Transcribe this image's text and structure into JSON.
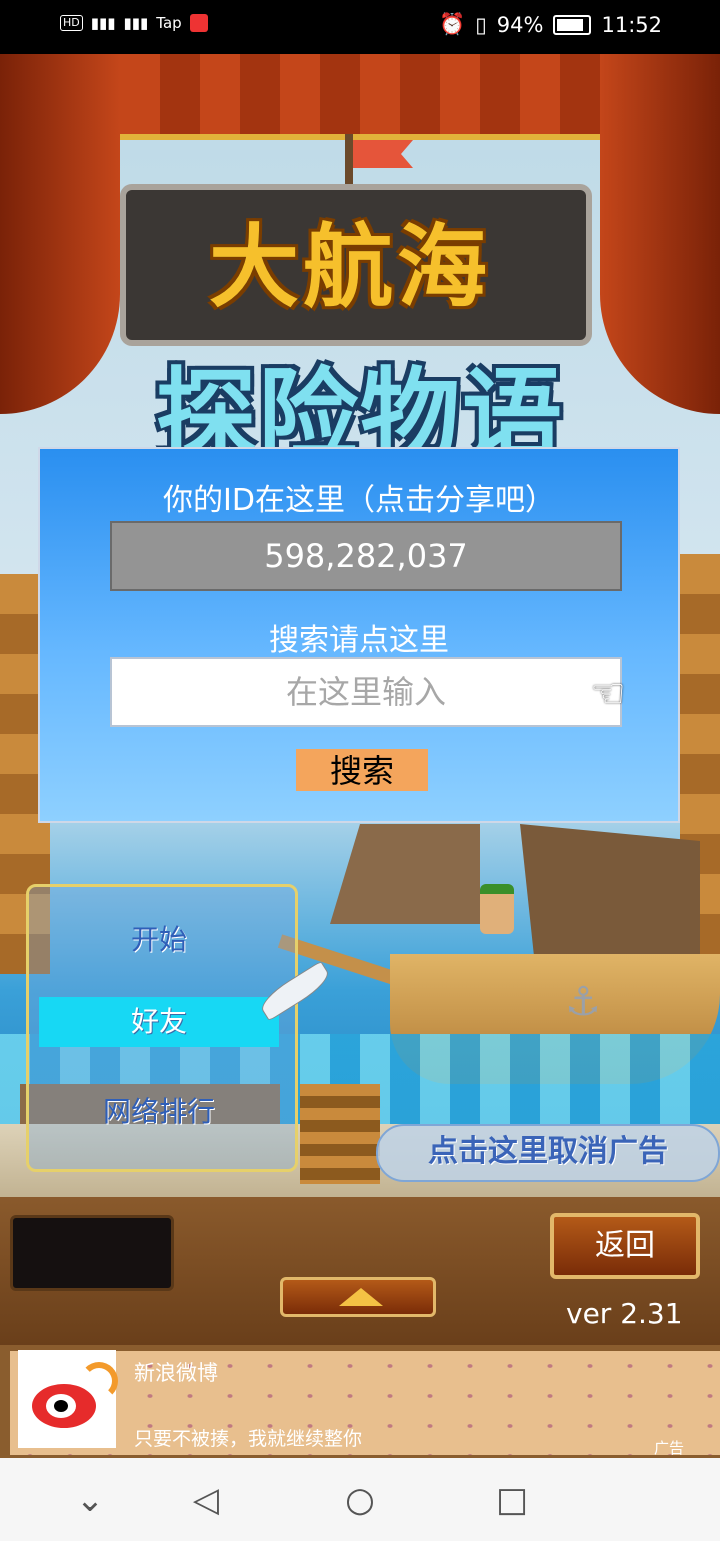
{
  "status_bar": {
    "left_indicators": [
      "HD",
      "4G",
      "4G",
      "Tap"
    ],
    "battery": "94%",
    "time": "11:52"
  },
  "dialog": {
    "title": "你的ID在这里（点击分享吧）",
    "id_value": "598,282,037",
    "search_label": "搜索请点这里",
    "search_placeholder": "在这里输入",
    "search_button": "搜索"
  },
  "menu": {
    "items": [
      "开始",
      "好友",
      "网络排行"
    ],
    "selected": "好友"
  },
  "cancel_ad_button": "点击这里取消广告",
  "game_bar": {
    "back_button": "返回",
    "version": "ver 2.31"
  },
  "ad": {
    "title": "新浪微博",
    "subtitle": "只要不被揍，我就继续整你",
    "tag": "广告"
  },
  "icons": {
    "nav_back": "back-triangle-icon",
    "nav_home": "home-circle-icon",
    "nav_recent": "recent-square-icon",
    "nav_hide": "chevron-down-icon"
  }
}
